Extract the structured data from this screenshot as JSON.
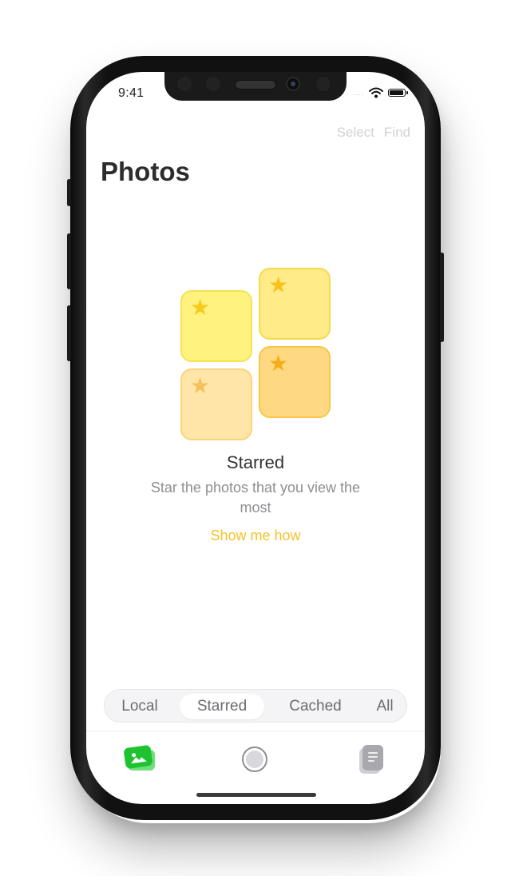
{
  "status_bar": {
    "time": "9:41",
    "signal": "....",
    "wifi_icon": "wifi-icon",
    "battery_icon": "battery-icon"
  },
  "header": {
    "select_label": "Select",
    "find_label": "Find",
    "title": "Photos"
  },
  "empty_state": {
    "illustration_icon": "star-icon",
    "title": "Starred",
    "subtitle": "Star the photos that you view the most",
    "cta_label": "Show me how"
  },
  "segments": {
    "items": [
      {
        "label": "Local",
        "active": false
      },
      {
        "label": "Starred",
        "active": true
      },
      {
        "label": "Cached",
        "active": false
      },
      {
        "label": "All",
        "active": false
      }
    ]
  },
  "tab_bar": {
    "items": [
      {
        "icon": "photos-icon",
        "active": true
      },
      {
        "icon": "capture-icon",
        "active": false
      },
      {
        "icon": "documents-icon",
        "active": false
      }
    ]
  },
  "colors": {
    "accent": "#f5c226",
    "title_text": "#2c2c2e",
    "muted_text": "#8e8e93",
    "header_action_text": "#d1d1d6",
    "photos_tab_green": "#1fc331"
  }
}
